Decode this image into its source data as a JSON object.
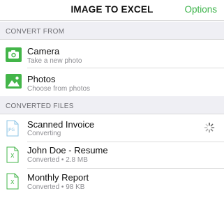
{
  "navbar": {
    "title": "IMAGE TO EXCEL",
    "options_label": "Options"
  },
  "sections": {
    "convert_from": "CONVERT FROM",
    "converted_files": "CONVERTED FILES"
  },
  "sources": [
    {
      "title": "Camera",
      "subtitle": "Take a new photo",
      "icon": "camera-icon"
    },
    {
      "title": "Photos",
      "subtitle": "Choose from photos",
      "icon": "photos-icon"
    }
  ],
  "files": [
    {
      "title": "Scanned Invoice",
      "status": "Converting",
      "icon": "jpg-file-icon",
      "icon_text": "JPG",
      "loading": true
    },
    {
      "title": "John Doe - Resume",
      "status": "Converted • 2.8 MB",
      "icon": "excel-file-icon",
      "icon_text": "X"
    },
    {
      "title": "Monthly Report",
      "status": "Converted • 98 KB",
      "icon": "excel-file-icon",
      "icon_text": "X"
    }
  ],
  "colors": {
    "accent": "#3cb34a",
    "icon_green": "#43b549",
    "jpg_blue": "#8ec4e6",
    "section_bg": "#efeff4"
  }
}
